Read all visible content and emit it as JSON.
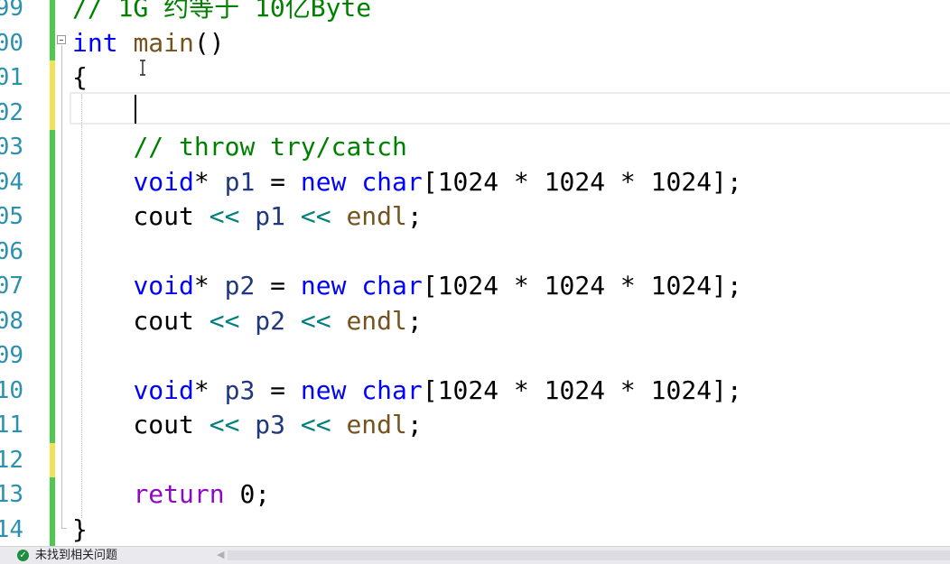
{
  "editor": {
    "lines": [
      {
        "num": "99",
        "bar": "#4ec94e",
        "tokens": [
          {
            "t": "// 1G 约等于 10亿Byte",
            "c": "cm"
          }
        ]
      },
      {
        "num": "00",
        "bar": "#4ec94e",
        "tokens": [
          {
            "t": "int",
            "c": "kw"
          },
          {
            "t": " "
          },
          {
            "t": "main",
            "c": "fn"
          },
          {
            "t": "()"
          }
        ]
      },
      {
        "num": "01",
        "bar": "#f5e05a",
        "tokens": [
          {
            "t": "{"
          }
        ]
      },
      {
        "num": "02",
        "bar": "#f5e05a",
        "tokens": []
      },
      {
        "num": "03",
        "bar": "#4ec94e",
        "tokens": [
          {
            "t": "    "
          },
          {
            "t": "// throw try/catch",
            "c": "cm"
          }
        ]
      },
      {
        "num": "04",
        "bar": "#4ec94e",
        "tokens": [
          {
            "t": "    "
          },
          {
            "t": "void",
            "c": "kw"
          },
          {
            "t": "* "
          },
          {
            "t": "p1",
            "c": "var"
          },
          {
            "t": " = "
          },
          {
            "t": "new",
            "c": "kw"
          },
          {
            "t": " "
          },
          {
            "t": "char",
            "c": "kw"
          },
          {
            "t": "[1024 * 1024 * 1024];"
          }
        ]
      },
      {
        "num": "05",
        "bar": "#4ec94e",
        "tokens": [
          {
            "t": "    cout "
          },
          {
            "t": "<<",
            "c": "op"
          },
          {
            "t": " "
          },
          {
            "t": "p1",
            "c": "var"
          },
          {
            "t": " "
          },
          {
            "t": "<<",
            "c": "op"
          },
          {
            "t": " "
          },
          {
            "t": "endl",
            "c": "fn"
          },
          {
            "t": ";"
          }
        ]
      },
      {
        "num": "06",
        "bar": "#4ec94e",
        "tokens": []
      },
      {
        "num": "07",
        "bar": "#4ec94e",
        "tokens": [
          {
            "t": "    "
          },
          {
            "t": "void",
            "c": "kw"
          },
          {
            "t": "* "
          },
          {
            "t": "p2",
            "c": "var"
          },
          {
            "t": " = "
          },
          {
            "t": "new",
            "c": "kw"
          },
          {
            "t": " "
          },
          {
            "t": "char",
            "c": "kw"
          },
          {
            "t": "[1024 * 1024 * 1024];"
          }
        ]
      },
      {
        "num": "08",
        "bar": "#4ec94e",
        "tokens": [
          {
            "t": "    cout "
          },
          {
            "t": "<<",
            "c": "op"
          },
          {
            "t": " "
          },
          {
            "t": "p2",
            "c": "var"
          },
          {
            "t": " "
          },
          {
            "t": "<<",
            "c": "op"
          },
          {
            "t": " "
          },
          {
            "t": "endl",
            "c": "fn"
          },
          {
            "t": ";"
          }
        ]
      },
      {
        "num": "09",
        "bar": "#4ec94e",
        "tokens": []
      },
      {
        "num": "10",
        "bar": "#4ec94e",
        "tokens": [
          {
            "t": "    "
          },
          {
            "t": "void",
            "c": "kw"
          },
          {
            "t": "* "
          },
          {
            "t": "p3",
            "c": "var"
          },
          {
            "t": " = "
          },
          {
            "t": "new",
            "c": "kw"
          },
          {
            "t": " "
          },
          {
            "t": "char",
            "c": "kw"
          },
          {
            "t": "[1024 * 1024 * 1024];"
          }
        ]
      },
      {
        "num": "11",
        "bar": "#4ec94e",
        "tokens": [
          {
            "t": "    cout "
          },
          {
            "t": "<<",
            "c": "op"
          },
          {
            "t": " "
          },
          {
            "t": "p3",
            "c": "var"
          },
          {
            "t": " "
          },
          {
            "t": "<<",
            "c": "op"
          },
          {
            "t": " "
          },
          {
            "t": "endl",
            "c": "fn"
          },
          {
            "t": ";"
          }
        ]
      },
      {
        "num": "12",
        "bar": "#f5e05a",
        "tokens": []
      },
      {
        "num": "13",
        "bar": "#4ec94e",
        "tokens": [
          {
            "t": "    "
          },
          {
            "t": "return",
            "c": "kw-ctl"
          },
          {
            "t": " 0;"
          }
        ]
      },
      {
        "num": "14",
        "bar": "#4ec94e",
        "tokens": [
          {
            "t": "}"
          }
        ]
      }
    ]
  },
  "status": {
    "icon": "check-circle-icon",
    "message": "未找到相关问题"
  },
  "colors": {
    "keyword": "#0000ff",
    "control_keyword": "#8f08c4",
    "comment": "#008000",
    "line_number": "#2b91af",
    "change_saved": "#4ec94e",
    "change_unsaved": "#f5e05a"
  }
}
